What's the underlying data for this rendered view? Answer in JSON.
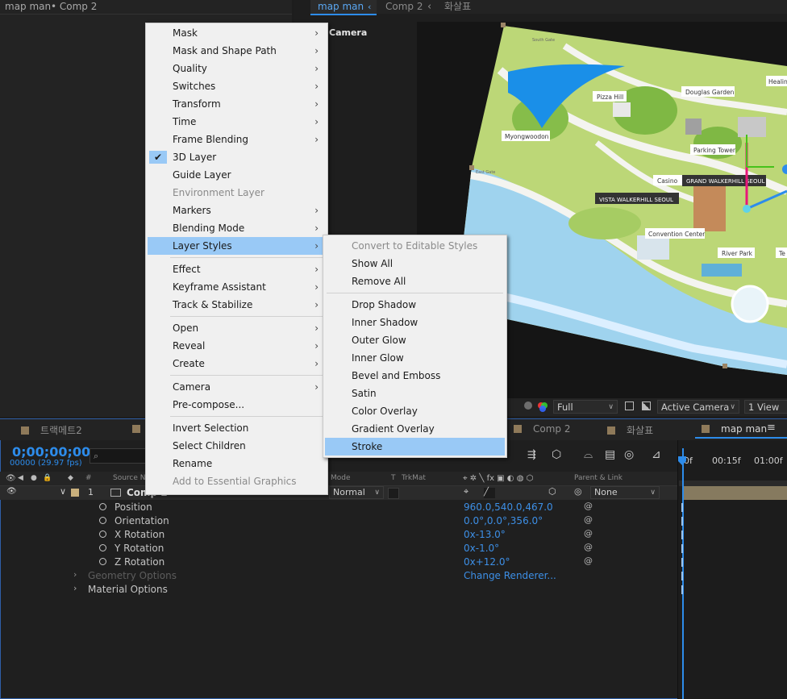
{
  "project_panel": {
    "title": "map man",
    "tab2": "• Comp 2"
  },
  "comp_tabs": {
    "active": "map man",
    "second": "Comp 2",
    "third": "화살표"
  },
  "viewer": {
    "camera_label": "Camera",
    "resolution": "Full",
    "camera": "Active Camera",
    "views": "1 View",
    "map_labels": [
      "Douglas Garden",
      "Pizza Hill",
      "Myongwoodon",
      "Healing",
      "Parking Tower",
      "Casino",
      "GRAND WALKERHILL SEOUL",
      "VISTA WALKERHILL SEOUL",
      "Convention Center",
      "River Park",
      "South Gate",
      "East Gate",
      "Te"
    ]
  },
  "context_menu": {
    "items": [
      {
        "label": "Mask",
        "submenu": true
      },
      {
        "label": "Mask and Shape Path",
        "submenu": true
      },
      {
        "label": "Quality",
        "submenu": true
      },
      {
        "label": "Switches",
        "submenu": true
      },
      {
        "label": "Transform",
        "submenu": true
      },
      {
        "label": "Time",
        "submenu": true
      },
      {
        "label": "Frame Blending",
        "submenu": true
      },
      {
        "label": "3D Layer",
        "checked": true
      },
      {
        "label": "Guide Layer"
      },
      {
        "label": "Environment Layer",
        "disabled": true
      },
      {
        "label": "Markers",
        "submenu": true
      },
      {
        "label": "Blending Mode",
        "submenu": true
      },
      {
        "label": "Layer Styles",
        "submenu": true,
        "highlighted": true
      },
      {
        "label": "Effect",
        "submenu": true
      },
      {
        "label": "Keyframe Assistant",
        "submenu": true
      },
      {
        "label": "Track & Stabilize",
        "submenu": true
      },
      {
        "label": "Open",
        "submenu": true
      },
      {
        "label": "Reveal",
        "submenu": true
      },
      {
        "label": "Create",
        "submenu": true
      },
      {
        "label": "Camera",
        "submenu": true
      },
      {
        "label": "Pre-compose..."
      },
      {
        "label": "Invert Selection"
      },
      {
        "label": "Select Children"
      },
      {
        "label": "Rename"
      },
      {
        "label": "Add to Essential Graphics",
        "disabled": true
      }
    ]
  },
  "layer_styles_submenu": {
    "items": [
      {
        "label": "Convert to Editable Styles",
        "disabled": true
      },
      {
        "label": "Show All"
      },
      {
        "label": "Remove All"
      },
      {
        "label": "Drop Shadow"
      },
      {
        "label": "Inner Shadow"
      },
      {
        "label": "Outer Glow"
      },
      {
        "label": "Inner Glow"
      },
      {
        "label": "Bevel and Emboss"
      },
      {
        "label": "Satin"
      },
      {
        "label": "Color Overlay"
      },
      {
        "label": "Gradient Overlay"
      },
      {
        "label": "Stroke",
        "highlighted": true
      }
    ]
  },
  "timeline": {
    "tabs": [
      "트랙메트2",
      "Comp 2",
      "화살표",
      "map man"
    ],
    "timecode": "0;00;00;00",
    "frames": "00000 (29.97 fps)",
    "search_placeholder": "⌕",
    "columns": {
      "source": "Source Na",
      "hash": "#",
      "mode": "Mode",
      "t": "T",
      "trkmat": "TrkMat",
      "parent": "Parent & Link"
    },
    "layer": {
      "number": "1",
      "name": "Comp 2",
      "mode": "Normal",
      "parent": "None"
    },
    "properties": [
      {
        "name": "Position",
        "value": "960.0,540.0,467.0"
      },
      {
        "name": "Orientation",
        "value": "0.0°,0.0°,356.0°"
      },
      {
        "name": "X Rotation",
        "value": "0x-13.0°"
      },
      {
        "name": "Y Rotation",
        "value": "0x-1.0°"
      },
      {
        "name": "Z Rotation",
        "value": "0x+12.0°"
      }
    ],
    "geometry_options": "Geometry Options",
    "change_renderer": "Change Renderer...",
    "material_options": "Material Options",
    "ruler": [
      "0f",
      "00:15f",
      "01:00f"
    ]
  }
}
